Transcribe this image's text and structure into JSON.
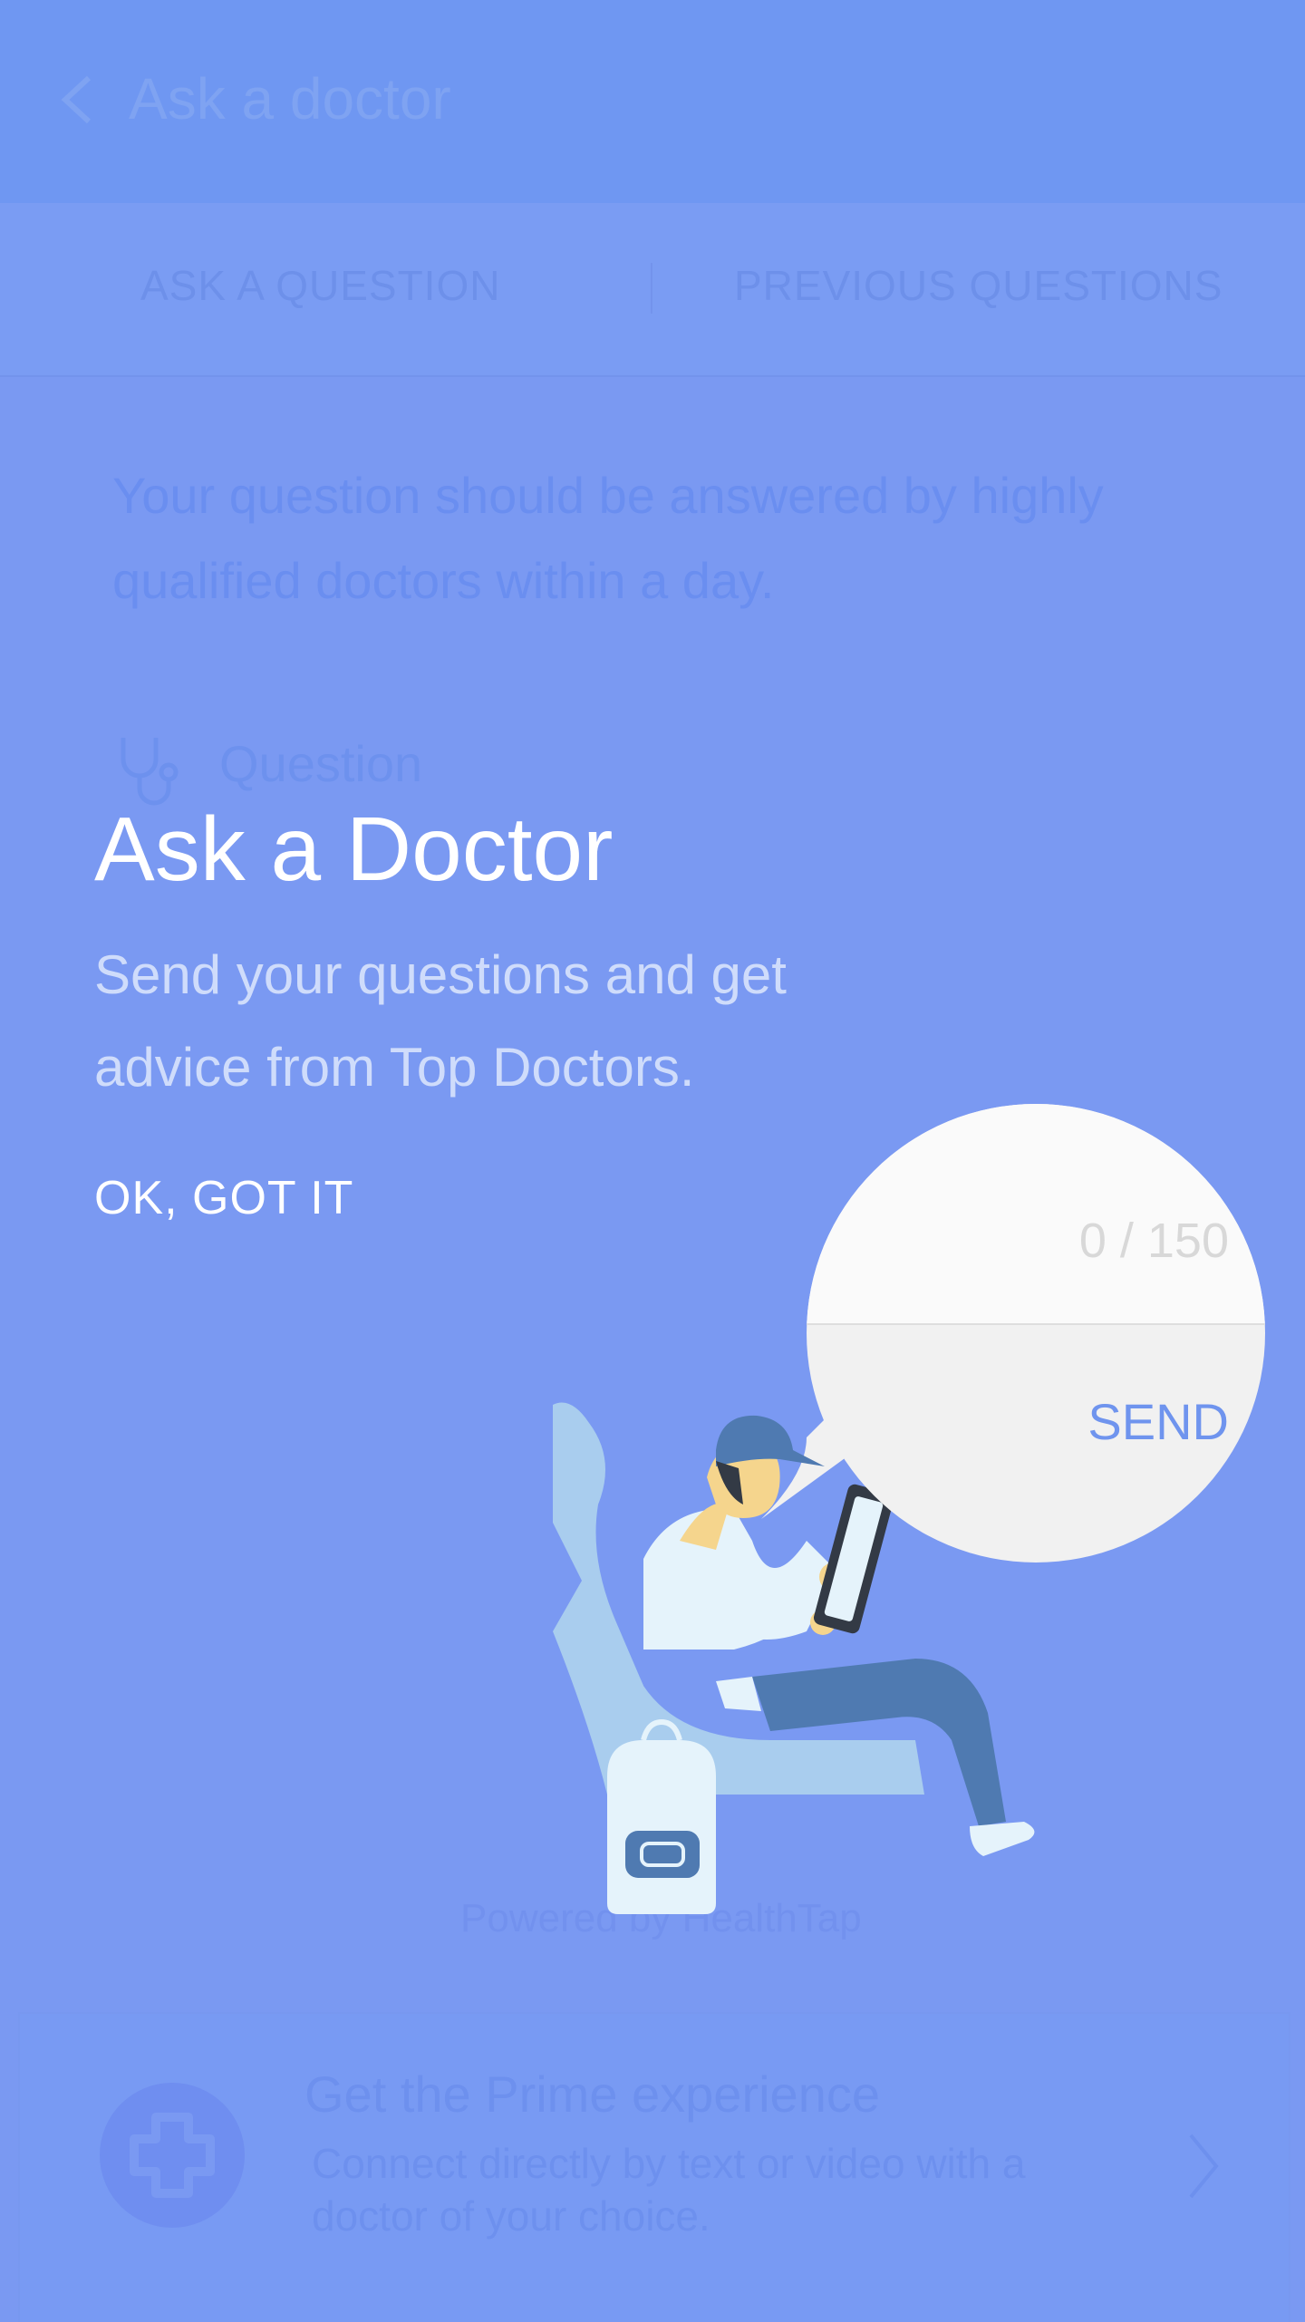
{
  "appbar": {
    "title": "Ask a doctor"
  },
  "tabs": [
    {
      "label": "ASK A QUESTION"
    },
    {
      "label": "PREVIOUS QUESTIONS"
    }
  ],
  "info": {
    "text": "Your question should be answered by highly qualified doctors within a day."
  },
  "question": {
    "label": "Question",
    "icon": "stethoscope-icon"
  },
  "footer": {
    "powered_by": "Powered by HealthTap"
  },
  "prime": {
    "title": "Get the Prime experience",
    "description": "Connect directly by text or video with a doctor of your choice."
  },
  "coach": {
    "title": "Ask a Doctor",
    "description": "Send your questions and get advice from Top Doctors.",
    "ok_label": "OK, GOT IT"
  },
  "bubble": {
    "counter": "0 / 150",
    "send_label": "SEND"
  },
  "colors": {
    "overlay": "#7a99f2",
    "accent": "#6f94ee",
    "white": "#ffffff"
  }
}
